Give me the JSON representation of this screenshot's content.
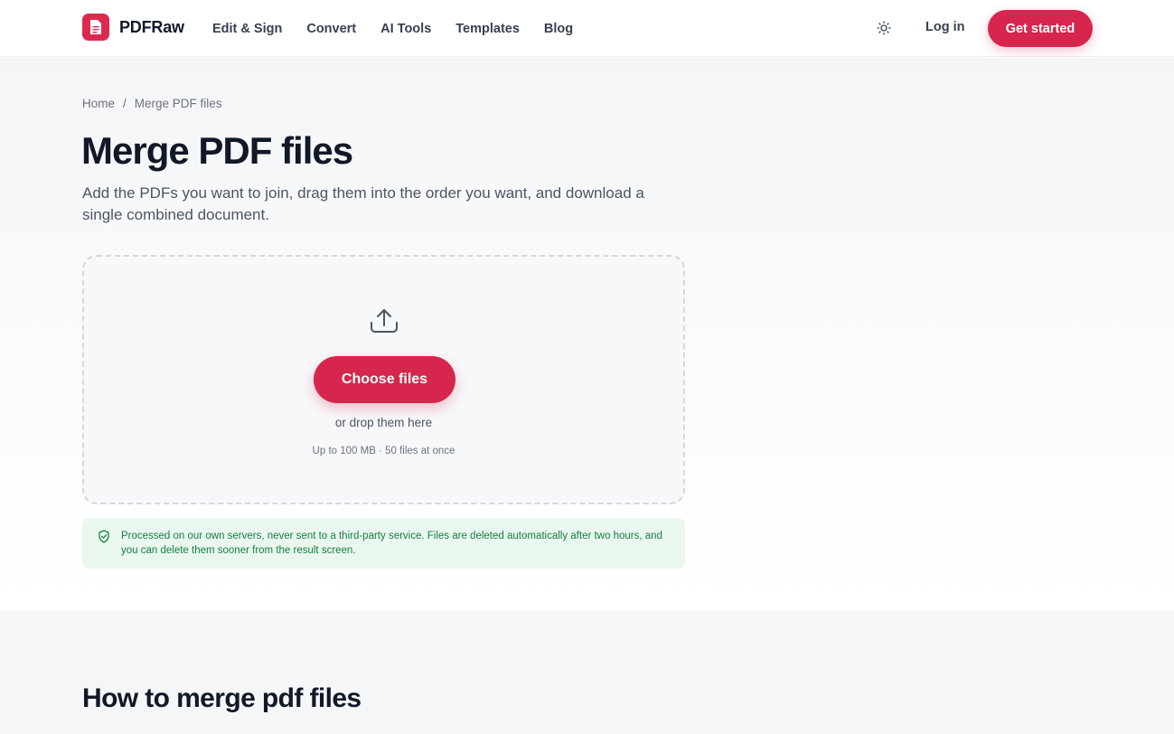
{
  "header": {
    "brand": "PDFRaw",
    "nav": [
      {
        "label": "Edit & Sign"
      },
      {
        "label": "Convert"
      },
      {
        "label": "AI Tools"
      },
      {
        "label": "Templates"
      },
      {
        "label": "Blog"
      }
    ],
    "theme_icon": "sun-icon",
    "login": "Log in",
    "cta": "Get started"
  },
  "breadcrumb": {
    "home": "Home",
    "separator": "/",
    "current": "Merge PDF files"
  },
  "hero": {
    "title": "Merge PDF files",
    "subtitle": "Add the PDFs you want to join, drag them into the order you want, and download a single combined document."
  },
  "dropzone": {
    "icon": "upload-icon",
    "button": "Choose files",
    "hint": "or drop them here",
    "limit": "Up to 100 MB · 50 files at once"
  },
  "notice": {
    "icon": "shield-check-icon",
    "text": "Processed on our own servers, never sent to a third-party service. Files are deleted automatically after two hours, and you can delete them sooner from the result screen."
  },
  "section2": {
    "heading": "How to merge pdf files"
  },
  "colors": {
    "accent": "#d6264d",
    "notice_bg": "#e9f7ef",
    "notice_text": "#15803d"
  }
}
